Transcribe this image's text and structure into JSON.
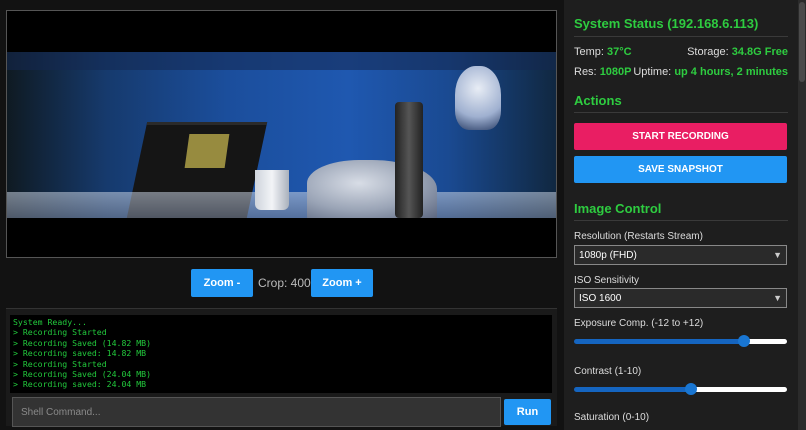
{
  "video": {
    "alt": "camera-stream"
  },
  "zoom": {
    "minus_label": "Zoom -",
    "plus_label": "Zoom +",
    "crop_text": "Crop: 400"
  },
  "terminal": {
    "lines": [
      "System Ready...",
      "> Recording Started",
      "> Recording Saved (14.82 MB)",
      "> Recording saved: 14.82 MB",
      "> Recording Started",
      "> Recording Saved (24.04 MB)",
      "> Recording saved: 24.04 MB"
    ],
    "input_placeholder": "Shell Command...",
    "run_label": "Run"
  },
  "status": {
    "title": "System Status (192.168.6.113)",
    "temp_label": "Temp:",
    "temp_value": "37°C",
    "storage_label": "Storage:",
    "storage_value": "34.8G Free",
    "res_label": "Res:",
    "res_value": "1080P",
    "uptime_label": "Uptime:",
    "uptime_value": "up 4 hours, 2 minutes"
  },
  "actions": {
    "title": "Actions",
    "record_label": "START RECORDING",
    "snapshot_label": "SAVE SNAPSHOT"
  },
  "image_control": {
    "title": "Image Control",
    "resolution_label": "Resolution (Restarts Stream)",
    "resolution_value": "1080p (FHD)",
    "iso_label": "ISO Sensitivity",
    "iso_value": "ISO 1600",
    "exposure_label": "Exposure Comp. (-12 to +12)",
    "exposure_fraction": 0.8,
    "contrast_label": "Contrast (1-10)",
    "contrast_fraction": 0.55,
    "saturation_label": "Saturation (0-10)"
  },
  "colors": {
    "accent_green": "#2ecc40",
    "record_pink": "#e91e63",
    "primary_blue": "#2196f3"
  }
}
